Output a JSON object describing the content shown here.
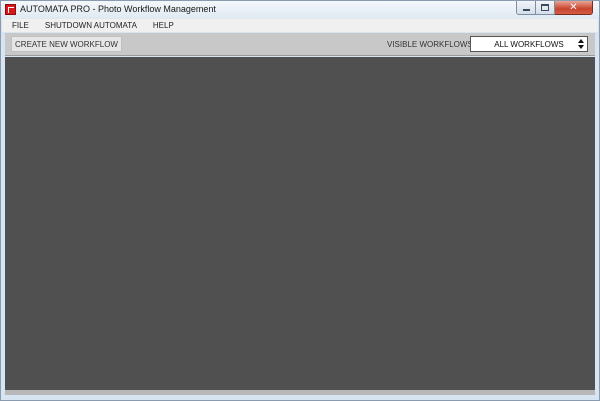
{
  "window": {
    "title": "AUTOMATA PRO - Photo Workflow Management",
    "icon": "automata-app-icon",
    "caption_buttons": [
      "minimize-icon",
      "maximize-icon",
      "close-icon"
    ]
  },
  "menu": {
    "items": [
      {
        "label": "FILE"
      },
      {
        "label": "SHUTDOWN AUTOMATA"
      },
      {
        "label": "HELP"
      }
    ]
  },
  "toolbar": {
    "create_label": "CREATE NEW WORKFLOW",
    "visible_label": "VISIBLE WORKFLOWS",
    "visible_selected": "ALL WORKFLOWS"
  },
  "colors": {
    "workspace": "#505050",
    "toolbar": "#c8c8c8",
    "close_button": "#c8442e",
    "app_icon": "#d8161b"
  }
}
